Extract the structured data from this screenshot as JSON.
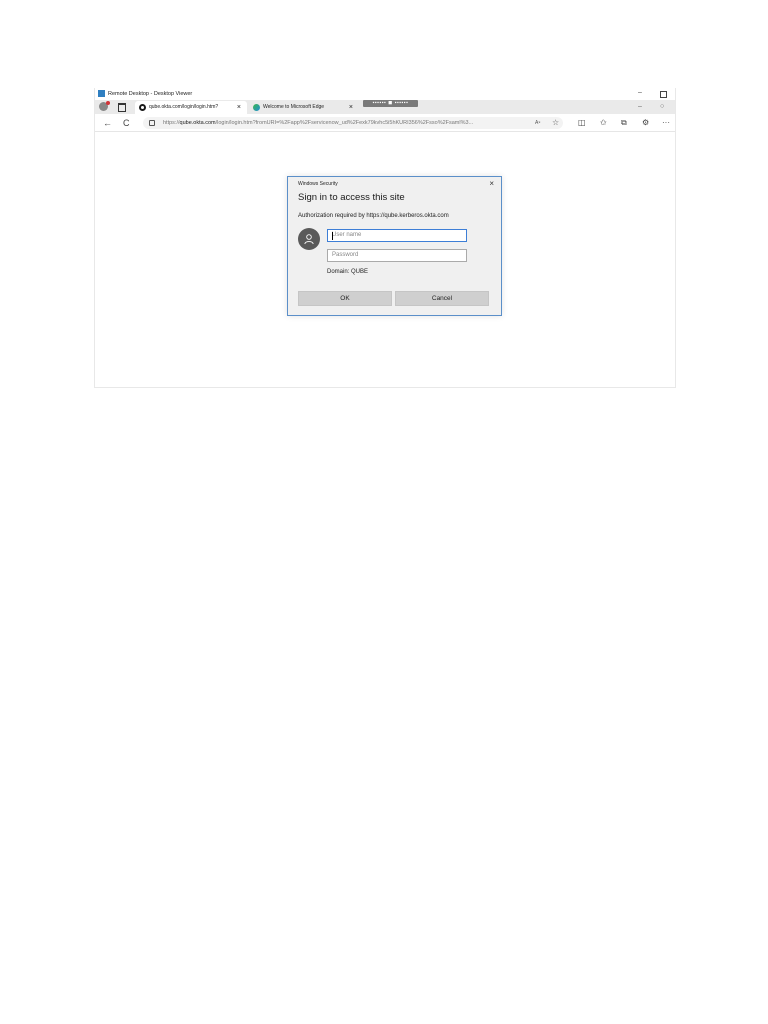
{
  "remote_desktop": {
    "title": "Remote Desktop - Desktop Viewer",
    "minimize": "–"
  },
  "browser": {
    "tabs": [
      {
        "label": "qube.okta.com/login/login.htm?",
        "close": "×",
        "icon": "okta-icon"
      },
      {
        "label": "Welcome to Microsoft Edge",
        "close": "×",
        "icon": "edge-icon"
      }
    ],
    "new_tab_label": "▪▪▪▪▪▪ ◼ ▪▪▪▪▪▪",
    "window_minimize": "–",
    "window_restore": "○",
    "nav": {
      "back": "←",
      "refresh": "C"
    },
    "url_prefix": "https://",
    "url_host": "qube.okta.com",
    "url_rest": "/login/login.htm?fromURI=%2Fapp%2Fservicenow_ud%2Fexk79kvhc5i5hKURI356%2Fsso%2Fsaml%3...",
    "read_aloud": "A⁹",
    "favorite_glyph": "☆",
    "toolbar": {
      "split": "◫",
      "favorites": "✩",
      "collections": "⧉",
      "extension": "⚙",
      "more": "···"
    }
  },
  "dialog": {
    "title": "Windows Security",
    "close": "×",
    "heading": "Sign in to access this site",
    "auth_text": "Authorization required by https://qube.kerberos.okta.com",
    "username_placeholder": "User name",
    "password_placeholder": "Password",
    "domain": "Domain: QUBE",
    "ok_label": "OK",
    "cancel_label": "Cancel"
  },
  "colors": {
    "dialog_border": "#5b8fc9",
    "focus_border": "#3d7ed6",
    "button_bg": "#cfcfcf",
    "avatar_bg": "#5a5a5a"
  }
}
